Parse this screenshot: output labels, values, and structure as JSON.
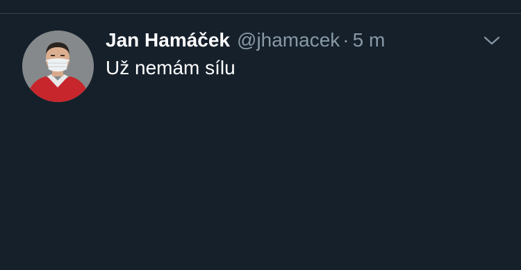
{
  "tweet": {
    "author": {
      "display_name": "Jan Hamáček",
      "handle": "@jhamacek"
    },
    "separator": "·",
    "timestamp": "5 m",
    "text": "Už nemám sílu"
  },
  "icons": {
    "menu": "chevron-down-icon",
    "avatar": "avatar"
  },
  "colors": {
    "background": "#15202b",
    "divider": "#38444d",
    "primary_text": "#ffffff",
    "secondary_text": "#8899a6"
  }
}
